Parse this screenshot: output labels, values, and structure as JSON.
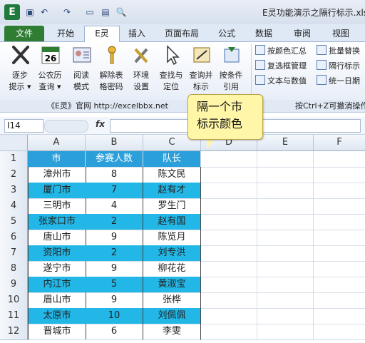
{
  "window": {
    "title": "E灵功能演示之隔行标示.xls"
  },
  "quick_access": [
    "save-icon",
    "undo-icon",
    "redo-icon",
    "new-icon",
    "open-icon",
    "preview-icon"
  ],
  "tabs": [
    "文件",
    "开始",
    "E灵",
    "插入",
    "页面布局",
    "公式",
    "数据",
    "审阅",
    "视图"
  ],
  "ribbon": {
    "buttons": [
      {
        "icon": "scissors-x-icon",
        "label": "逐步",
        "sub": "提示 ▾"
      },
      {
        "icon": "calendar-icon",
        "label": "公农历",
        "sub": "查询 ▾"
      },
      {
        "icon": "read-mode-icon",
        "label": "阅读",
        "sub": "模式"
      },
      {
        "icon": "key-icon",
        "label": "解除表",
        "sub": "格密码"
      },
      {
        "icon": "tools-icon",
        "label": "环境",
        "sub": "设置"
      },
      {
        "icon": "cursor-icon",
        "label": "查找与",
        "sub": "定位"
      },
      {
        "icon": "merge-icon",
        "label": "查询并",
        "sub": "标示"
      },
      {
        "icon": "conditional-ref-icon",
        "label": "按条件",
        "sub": "引用"
      }
    ],
    "small": [
      [
        "按颜色汇总",
        "批量替换"
      ],
      [
        "复选框管理",
        "隔行标示"
      ],
      [
        "文本与数值",
        "统一日期"
      ]
    ],
    "footer_left": "《E灵》官网  http://excelbbx.net",
    "footer_right": "按Ctrl+Z可撤消操作"
  },
  "formula_bar": {
    "name_box": "I14",
    "fx": "fx",
    "content": ""
  },
  "callout": {
    "line1": "隔一个市",
    "line2": "标示颜色"
  },
  "columns": [
    "A",
    "B",
    "C",
    "D",
    "E",
    "F"
  ],
  "rows": [
    "1",
    "2",
    "3",
    "4",
    "5",
    "6",
    "7",
    "8",
    "9",
    "10",
    "11",
    "12"
  ],
  "table": {
    "headers": [
      "市",
      "参赛人数",
      "队长"
    ],
    "data": [
      [
        "漳州市",
        "8",
        "陈文民"
      ],
      [
        "厦门市",
        "7",
        "赵有才"
      ],
      [
        "三明市",
        "4",
        "罗生门"
      ],
      [
        "张家口市",
        "2",
        "赵有国"
      ],
      [
        "唐山市",
        "9",
        "陈览月"
      ],
      [
        "资阳市",
        "2",
        "刘专洪"
      ],
      [
        "遂宁市",
        "9",
        "柳花花"
      ],
      [
        "内江市",
        "5",
        "黄淑宝"
      ],
      [
        "眉山市",
        "9",
        "张桦"
      ],
      [
        "太原市",
        "10",
        "刘佩佩"
      ],
      [
        "晋城市",
        "6",
        "李雯"
      ]
    ]
  },
  "colors": {
    "highlight": "#22b7e6",
    "header": "#2a9fd9",
    "file_tab": "#2e7d32",
    "callout": "#fff6a8"
  }
}
